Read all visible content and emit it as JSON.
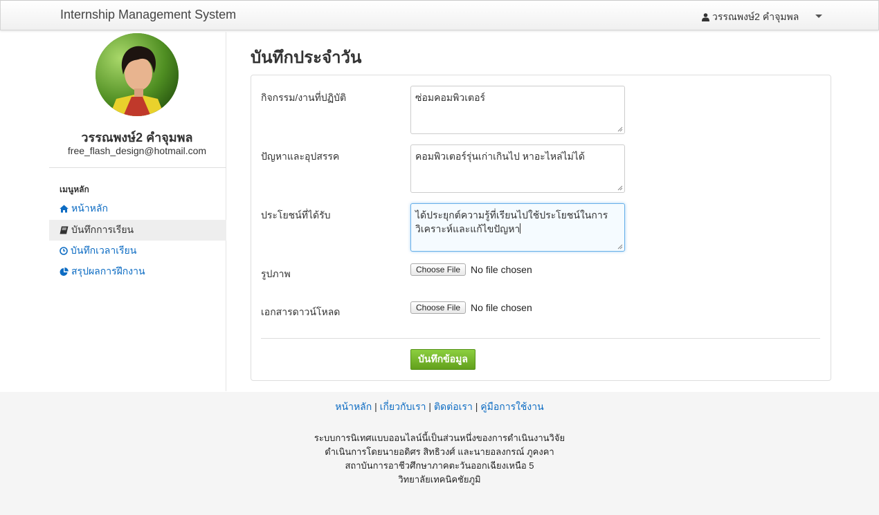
{
  "app": {
    "title": "Internship Management System"
  },
  "user": {
    "display_name": "วรรณพงษ์2 คำจุมพล"
  },
  "profile": {
    "name": "วรรณพงษ์2 คำจุมพล",
    "email": "free_flash_design@hotmail.com"
  },
  "sidebar": {
    "header": "เมนูหลัก",
    "items": [
      {
        "label": "หน้าหลัก",
        "icon": "home-icon"
      },
      {
        "label": "บันทึกการเรียน",
        "icon": "book-icon",
        "active": true
      },
      {
        "label": "บันทึกเวลาเรียน",
        "icon": "clock-icon"
      },
      {
        "label": "สรุปผลการฝึกงาน",
        "icon": "pie-chart-icon"
      }
    ]
  },
  "page": {
    "title": "บันทึกประจำวัน"
  },
  "form": {
    "activity": {
      "label": "กิจกรรม/งานที่ปฏิบัติ",
      "value": "ซ่อมคอมพิวเตอร์"
    },
    "problems": {
      "label": "ปัญหาและอุปสรรค",
      "value": "คอมพิวเตอร์รุ่นเก่าเกินไป หาอะไหล่ไม่ได้"
    },
    "benefits": {
      "label": "ประโยชน์ที่ได้รับ",
      "line1": "ได้ประยุกต์ความรู้ที่เรียนไปใช้ประโยชน์ในการ",
      "line2": "วิเคราะห์และแก้ไขปัญหา"
    },
    "image": {
      "label": "รูปภาพ",
      "button": "Choose File",
      "status": "No file chosen"
    },
    "document": {
      "label": "เอกสารดาวน์โหลด",
      "button": "Choose File",
      "status": "No file chosen"
    },
    "submit_label": "บันทึกข้อมูล"
  },
  "footer": {
    "links": [
      "หน้าหลัก",
      "เกี่ยวกับเรา",
      "ติดต่อเรา",
      "คู่มือการใช้งาน"
    ],
    "separator": "|",
    "lines": [
      "ระบบการนิเทศแบบออนไลน์นี้เป็นส่วนหนึ่งของการดำเนินงานวิจัย",
      "ดำเนินการโดยนายอดิศร สิทธิวงศ์ และนายอลงกรณ์ ภูคงคา",
      "สถาบันการอาชีวศึกษาภาคตะวันออกเฉียงเหนือ 5",
      "วิทยาลัยเทคนิคชัยภูมิ"
    ]
  },
  "colors": {
    "link": "#0d6cc3",
    "submit": "#6fae26",
    "focus_border": "#66afe9"
  }
}
